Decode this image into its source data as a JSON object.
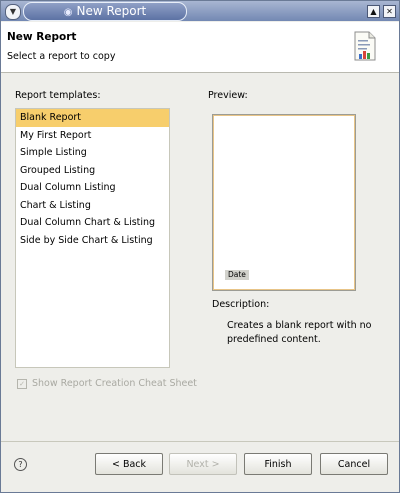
{
  "window": {
    "title": "New Report",
    "menu_icon": "chevron-down-icon",
    "title_icon": "globe-icon"
  },
  "titlebar_buttons": {
    "maximize": "▲",
    "close": "✕"
  },
  "header": {
    "title": "New Report",
    "subtitle": "Select a report to copy",
    "icon": "report-icon"
  },
  "templates": {
    "label": "Report templates:",
    "items": [
      "Blank Report",
      "My First Report",
      "Simple Listing",
      "Grouped Listing",
      "Dual Column Listing",
      "Chart & Listing",
      "Dual Column Chart & Listing",
      "Side by Side Chart & Listing"
    ],
    "selected": "Blank Report"
  },
  "preview": {
    "label": "Preview:",
    "date_text": "Date"
  },
  "description": {
    "label": "Description:",
    "text": "Creates a blank report with no predefined content."
  },
  "cheat_sheet": {
    "label": "Show Report Creation Cheat Sheet",
    "checked": true,
    "enabled": false
  },
  "buttons": {
    "back": "< Back",
    "next": "Next >",
    "finish": "Finish",
    "cancel": "Cancel"
  },
  "help_icon": "help-icon"
}
